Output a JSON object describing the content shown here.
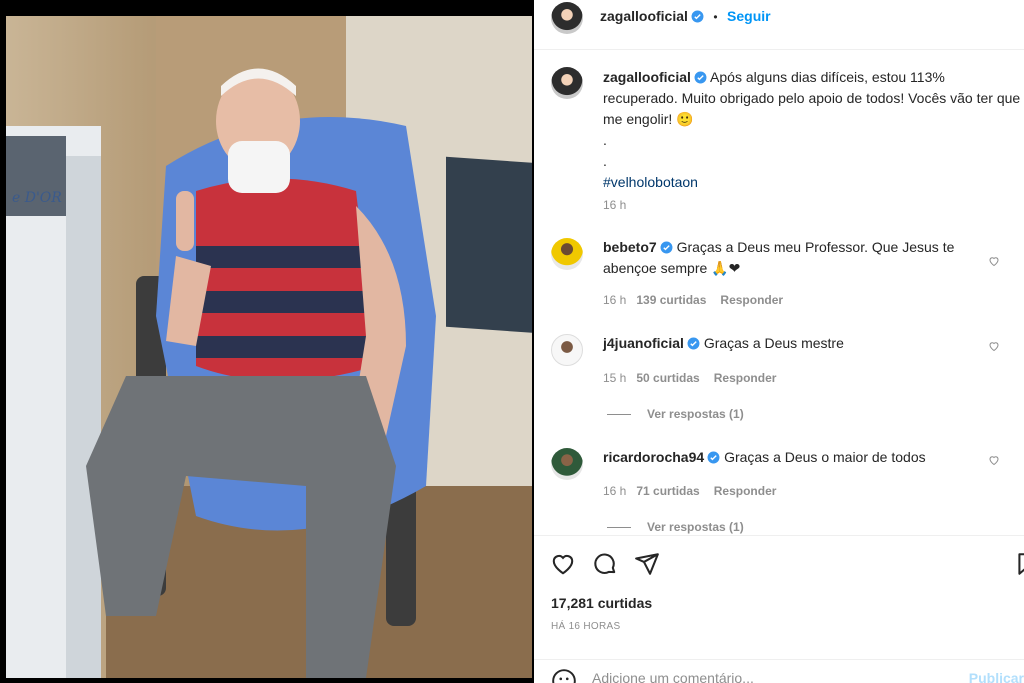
{
  "header": {
    "username": "zagallooficial",
    "separator": "•",
    "follow_label": "Seguir"
  },
  "caption": {
    "username": "zagallooficial",
    "text": "Após alguns dias difíceis, estou 113% recuperado. Muito obrigado pelo apoio de todos! Vocês vão ter que me engolir! 🙂",
    "dot1": ".",
    "dot2": ".",
    "hashtag": "#velholobotaon",
    "time": "16 h"
  },
  "comments": [
    {
      "username": "bebeto7",
      "text": "Graças a Deus meu Professor. Que Jesus te abençoe sempre 🙏❤",
      "time": "16 h",
      "likes": "139 curtidas",
      "reply": "Responder"
    },
    {
      "username": "j4juanoficial",
      "text": "Graças a Deus mestre",
      "time": "15 h",
      "likes": "50 curtidas",
      "reply": "Responder",
      "view_replies": "Ver respostas (1)"
    },
    {
      "username": "ricardorocha94",
      "text": "Graças a Deus o maior de todos",
      "time": "16 h",
      "likes": "71 curtidas",
      "reply": "Responder",
      "view_replies": "Ver respostas (1)"
    }
  ],
  "footer": {
    "likes": "17,281 curtidas",
    "posted": "HÁ 16 HORAS",
    "comment_placeholder": "Adicione um comentário...",
    "publish_label": "Publicar"
  },
  "icons": {
    "verified": "verified-badge-icon",
    "like": "heart-icon",
    "comment": "comment-bubble-icon",
    "share": "paper-plane-icon",
    "save": "bookmark-icon",
    "emoji": "smiley-icon"
  },
  "colors": {
    "accent": "#0095f6",
    "hashtag": "#00376b",
    "muted": "#8e8e8e"
  }
}
